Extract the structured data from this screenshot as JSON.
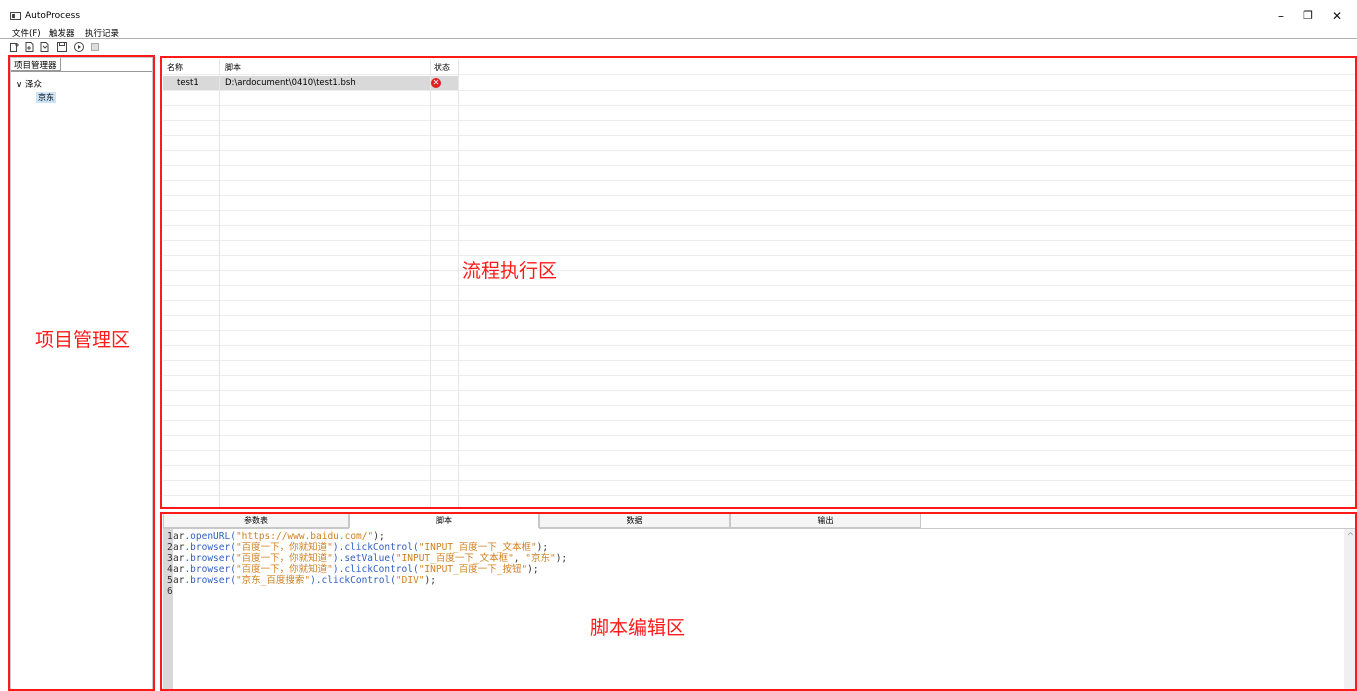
{
  "window": {
    "title": "AutoProcess",
    "minimize": "–",
    "restore": "❐",
    "close": "✕"
  },
  "menu": [
    "文件(F)",
    "触发器",
    "执行记录"
  ],
  "toolbar": {
    "icons": [
      "new-project-icon",
      "add-file-icon",
      "import-file-icon",
      "save-icon",
      "run-icon",
      "stop-icon"
    ]
  },
  "project_pane": {
    "tab": "项目管理器",
    "root": {
      "expander": "∨",
      "label": "泽众"
    },
    "child": "京东"
  },
  "run_table": {
    "headers": {
      "name": "名称",
      "script": "脚本",
      "status": "状态"
    },
    "rows": [
      {
        "name": "test1",
        "script": "D:\\ardocument\\0410\\test1.bsh",
        "status_icon": "error-icon",
        "status_symbol": "✕"
      }
    ]
  },
  "bottom_tabs": [
    "参数表",
    "脚本",
    "数据",
    "输出"
  ],
  "bottom_active_tab": "脚本",
  "code": {
    "line_numbers": [
      "1",
      "2",
      "3",
      "4",
      "5",
      "6"
    ],
    "lines": [
      [
        {
          "t": "ar",
          "c": "plain"
        },
        {
          "t": ".openURL(",
          "c": "fn"
        },
        {
          "t": "\"https://www.baidu.com/\"",
          "c": "str"
        },
        {
          "t": ");",
          "c": "plain"
        }
      ],
      [
        {
          "t": "ar",
          "c": "plain"
        },
        {
          "t": ".browser(",
          "c": "fn"
        },
        {
          "t": "\"百度一下，你就知道\"",
          "c": "str"
        },
        {
          "t": ").clickControl(",
          "c": "fn"
        },
        {
          "t": "\"INPUT_百度一下_文本框\"",
          "c": "str"
        },
        {
          "t": ");",
          "c": "plain"
        }
      ],
      [
        {
          "t": "ar",
          "c": "plain"
        },
        {
          "t": ".browser(",
          "c": "fn"
        },
        {
          "t": "\"百度一下，你就知道\"",
          "c": "str"
        },
        {
          "t": ").setValue(",
          "c": "fn"
        },
        {
          "t": "\"INPUT_百度一下_文本框\"",
          "c": "str"
        },
        {
          "t": ", ",
          "c": "plain"
        },
        {
          "t": "\"京东\"",
          "c": "str"
        },
        {
          "t": ");",
          "c": "plain"
        }
      ],
      [
        {
          "t": "ar",
          "c": "plain"
        },
        {
          "t": ".browser(",
          "c": "fn"
        },
        {
          "t": "\"百度一下，你就知道\"",
          "c": "str"
        },
        {
          "t": ").clickControl(",
          "c": "fn"
        },
        {
          "t": "\"INPUT_百度一下_按钮\"",
          "c": "str"
        },
        {
          "t": ");",
          "c": "plain"
        }
      ],
      [
        {
          "t": "ar",
          "c": "plain"
        },
        {
          "t": ".browser(",
          "c": "fn"
        },
        {
          "t": "\"京东_百度搜索\"",
          "c": "str"
        },
        {
          "t": ").clickControl(",
          "c": "fn"
        },
        {
          "t": "\"DIV\"",
          "c": "str"
        },
        {
          "t": ");",
          "c": "plain"
        }
      ],
      []
    ]
  },
  "annotations": {
    "project_area": "项目管理区",
    "flow_area": "流程执行区",
    "script_area": "脚本编辑区"
  },
  "colors": {
    "annotation_red": "#ff1a1a",
    "selected_row": "#d9d9d9",
    "tree_selection": "#cce4f7",
    "code_function": "#3060c0",
    "code_string": "#d08020"
  }
}
